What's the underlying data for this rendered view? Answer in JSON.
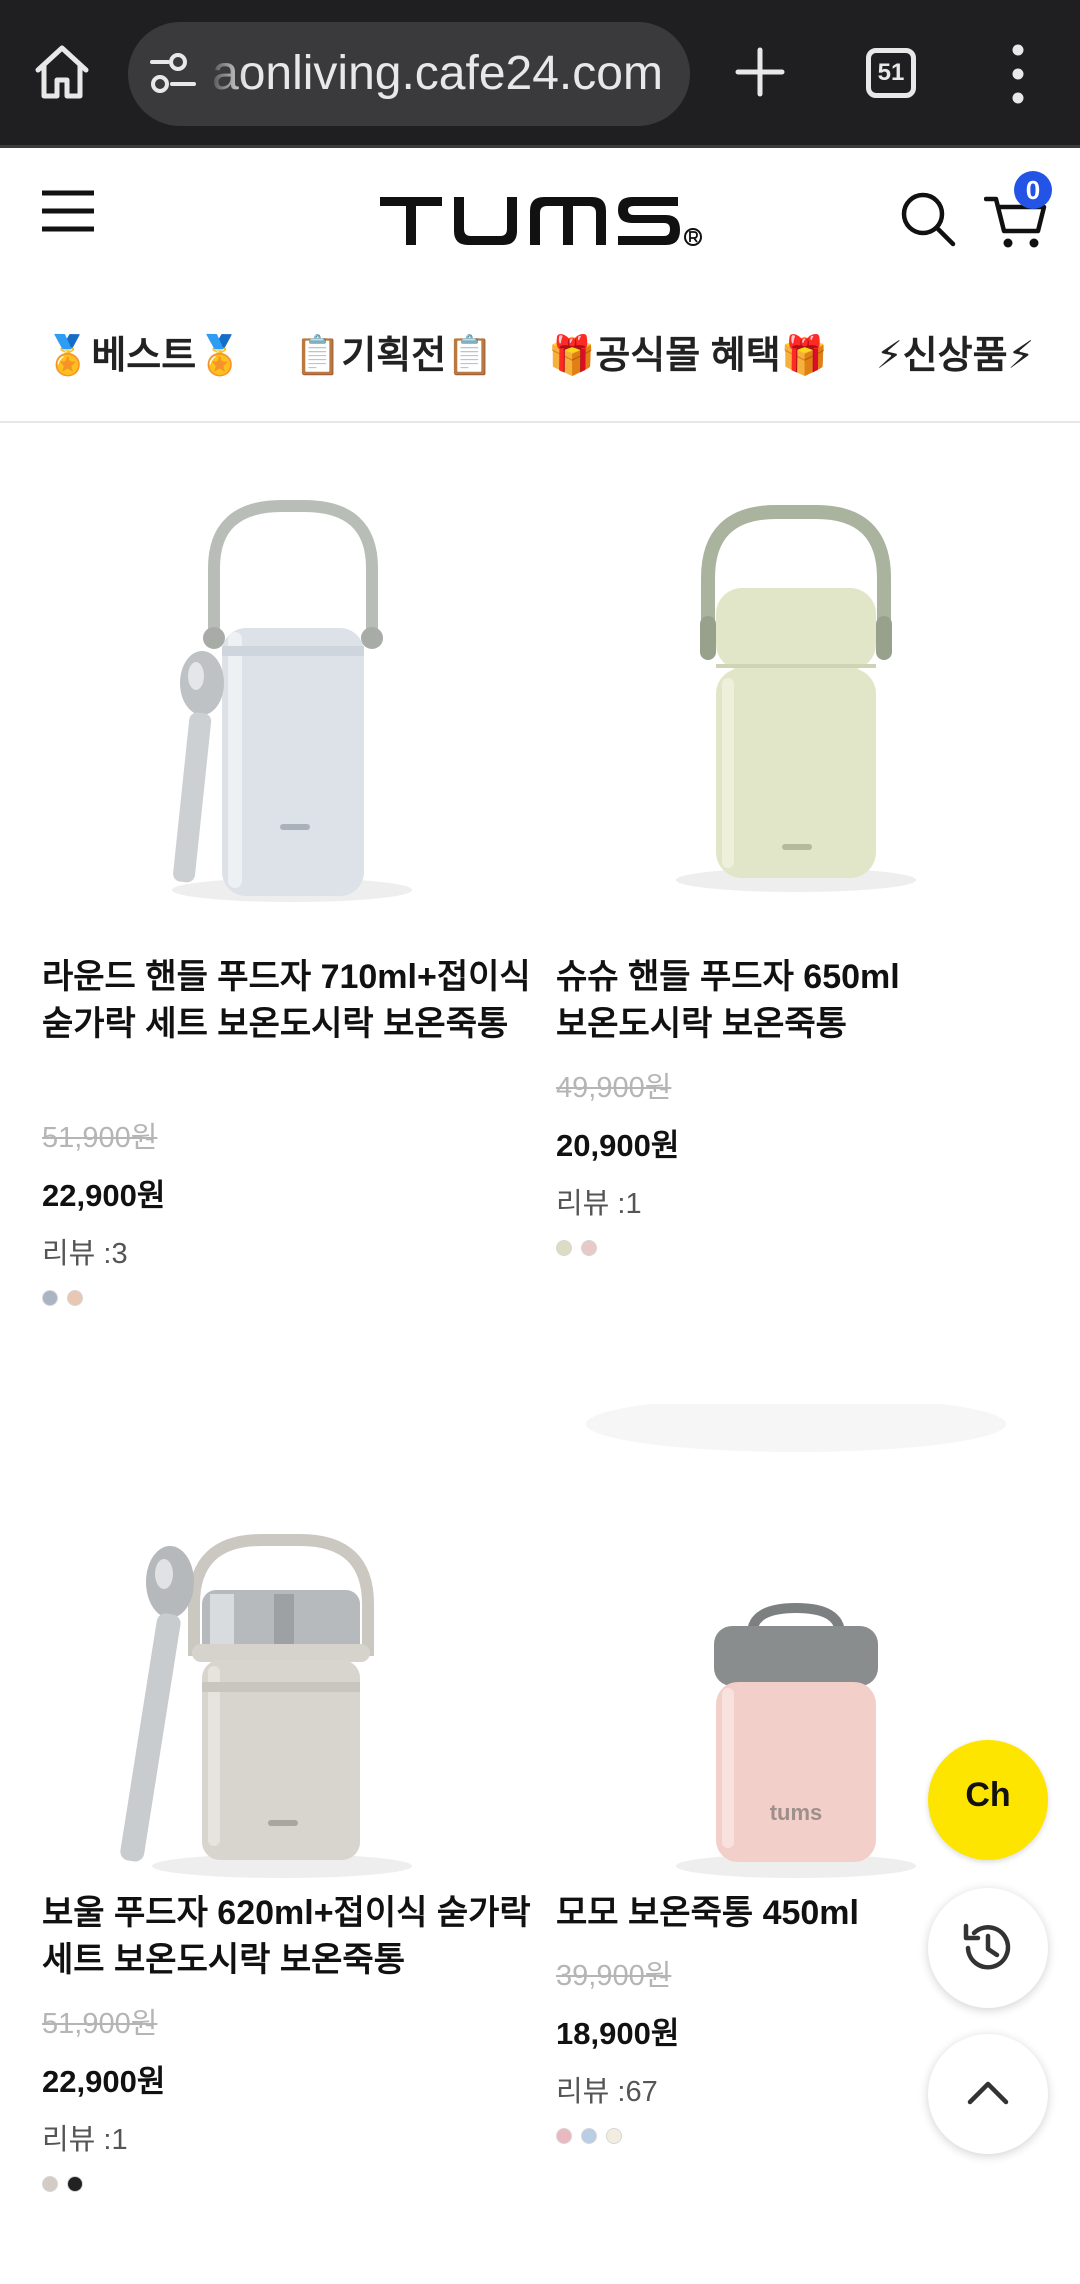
{
  "browser": {
    "url": "aonliving.cafe24.com",
    "tab_count": "51"
  },
  "header": {
    "logo_text": "TUMS",
    "cart_count": "0"
  },
  "categories": [
    {
      "label": "🏅베스트🏅"
    },
    {
      "label": "📋기획전📋"
    },
    {
      "label": "🎁공식몰 혜택🎁"
    },
    {
      "label": "⚡신상품⚡"
    }
  ],
  "products": [
    {
      "name": "라운드 핸들 푸드자 710ml+접이식 숟가락 세트 보온도시락 보온죽통",
      "original_price": "51,900원",
      "sale_price": "22,900원",
      "review": "리뷰 :3",
      "swatches": [
        "#a9b4c4",
        "#e8c8b2"
      ],
      "body_color": "#dde2e8",
      "handle_color": "#b8beb7"
    },
    {
      "name": "슈슈 핸들 푸드자 650ml 보온도시락 보온죽통",
      "original_price": "49,900원",
      "sale_price": "20,900원",
      "review": "리뷰 :1",
      "swatches": [
        "#dcdcc4",
        "#e9c8c8"
      ],
      "body_color": "#e2e6c8",
      "handle_color": "#a9b39e"
    },
    {
      "name": "보울 푸드자 620ml+접이식 숟가락 세트 보온도시락 보온죽통",
      "original_price": "51,900원",
      "sale_price": "22,900원",
      "review": "리뷰 :1",
      "swatches": [
        "#d4ccc4",
        "#222222"
      ],
      "body_color": "#d8d5cf",
      "handle_color": "#c9c6c0"
    },
    {
      "name": "모모 보온죽통 450ml",
      "original_price": "39,900원",
      "sale_price": "18,900원",
      "review": "리뷰 :67",
      "swatches": [
        "#eab8c0",
        "#b9cde4",
        "#f3ece0"
      ],
      "body_color": "#f2cfc9",
      "lid_color": "#8a8d8e",
      "thumb_brand": "tums"
    }
  ],
  "floating": {
    "chat_label": "Ch"
  },
  "colors": {
    "brand_badge": "#2454e6",
    "chat_button": "#fde500",
    "chrome_bg": "#1f1f21"
  }
}
